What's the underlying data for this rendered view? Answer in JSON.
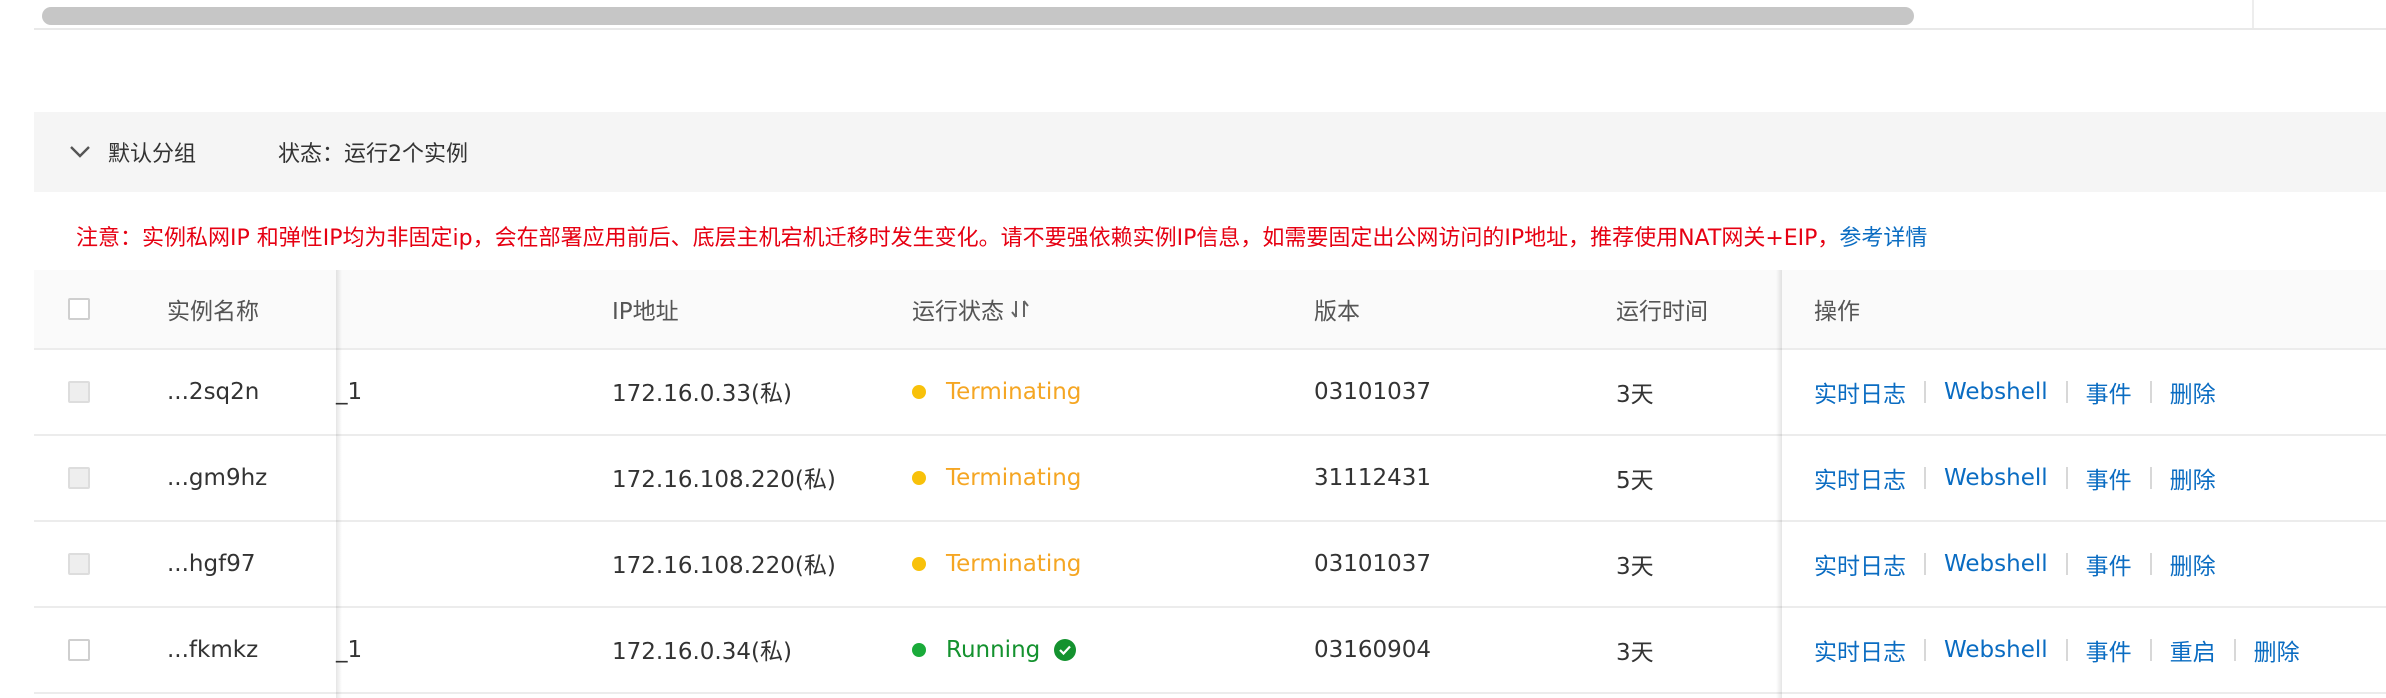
{
  "group": {
    "name": "默认分组",
    "status": "状态：运行2个实例"
  },
  "notice": {
    "text": "注意：实例私网IP 和弹性IP均为非固定ip，会在部署应用前后、底层主机宕机迁移时发生变化。请不要强依赖实例IP信息，如需要固定出公网访问的IP地址，推荐使用NAT网关+EIP，",
    "link": "参考详情"
  },
  "table": {
    "columns": {
      "name": "实例名称",
      "ip": "IP地址",
      "status": "运行状态",
      "version": "版本",
      "time": "运行时间",
      "ops": "操作"
    },
    "rows": [
      {
        "name": "...2sq2n",
        "suffix": "_1",
        "ip": "172.16.0.33(私)",
        "status": "Terminating",
        "version": "03101037",
        "time": "3天",
        "ops": [
          "实时日志",
          "Webshell",
          "事件",
          "删除"
        ]
      },
      {
        "name": "...gm9hz",
        "suffix": "",
        "ip": "172.16.108.220(私)",
        "status": "Terminating",
        "version": "31112431",
        "time": "5天",
        "ops": [
          "实时日志",
          "Webshell",
          "事件",
          "删除"
        ]
      },
      {
        "name": "...hgf97",
        "suffix": "",
        "ip": "172.16.108.220(私)",
        "status": "Terminating",
        "version": "03101037",
        "time": "3天",
        "ops": [
          "实时日志",
          "Webshell",
          "事件",
          "删除"
        ]
      },
      {
        "name": "...fkmkz",
        "suffix": "_1",
        "ip": "172.16.0.34(私)",
        "status": "Running",
        "version": "03160904",
        "time": "3天",
        "ops": [
          "实时日志",
          "Webshell",
          "事件",
          "重启",
          "删除"
        ]
      }
    ]
  },
  "colors": {
    "terminating": "#f8c10a",
    "running": "#1aab3a",
    "running_text": "#14922f",
    "terminating_text": "#f5a623",
    "link": "#0a6cc2",
    "notice": "#e60012"
  },
  "icons": {
    "collapse": "chevron-down-icon",
    "sort": "sort-icon",
    "ok": "check-circle-icon"
  }
}
